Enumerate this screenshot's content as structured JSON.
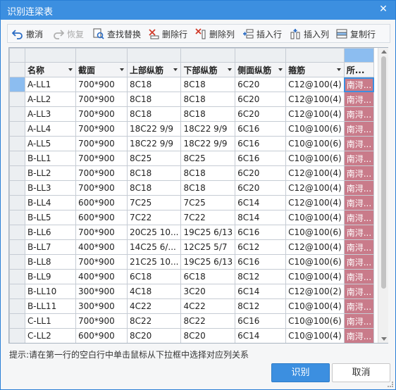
{
  "window": {
    "title": "识别连梁表",
    "close_glyph": "✕"
  },
  "toolbar": {
    "undo": "撤消",
    "redo": "恢复",
    "find_replace": "查找替换",
    "delete_row": "删除行",
    "delete_col": "删除列",
    "insert_row": "插入行",
    "insert_col": "插入列",
    "copy_row": "复制行"
  },
  "table": {
    "columns": [
      "名称",
      "截面",
      "上部纵筋",
      "下部纵筋",
      "侧面纵筋",
      "箍筋",
      "所..."
    ],
    "rows": [
      [
        "A-LL1",
        "700*900",
        "8C18",
        "8C18",
        "6C20",
        "C12@100(4)",
        "南浔..."
      ],
      [
        "A-LL2",
        "700*900",
        "8C18",
        "8C18",
        "6C20",
        "C12@100(4)",
        "南浔..."
      ],
      [
        "A-LL3",
        "700*900",
        "8C18",
        "8C18",
        "6C20",
        "C12@100(4)",
        "南浔..."
      ],
      [
        "A-LL4",
        "700*900",
        "18C22 9/9",
        "18C22 9/9",
        "6C16",
        "C10@100(6)",
        "南浔..."
      ],
      [
        "A-LL5",
        "700*900",
        "18C22 9/9",
        "18C22 9/9",
        "6C16",
        "C10@100(6)",
        "南浔..."
      ],
      [
        "B-LL1",
        "700*900",
        "8C25",
        "8C25",
        "6C16",
        "C10@100(6)",
        "南浔..."
      ],
      [
        "B-LL2",
        "700*900",
        "8C18",
        "8C18",
        "6C20",
        "C12@100(4)",
        "南浔..."
      ],
      [
        "B-LL3",
        "700*900",
        "8C18",
        "8C18",
        "6C20",
        "C12@100(4)",
        "南浔..."
      ],
      [
        "B-LL4",
        "600*900",
        "7C25",
        "7C25",
        "6C14",
        "C12@100(4)",
        "南浔..."
      ],
      [
        "B-LL5",
        "600*900",
        "7C22",
        "7C22",
        "8C14",
        "C10@100(4)",
        "南浔..."
      ],
      [
        "B-LL6",
        "700*900",
        "20C25 10...",
        "19C25 6/13",
        "6C16",
        "C10@100(6)",
        "南浔..."
      ],
      [
        "B-LL7",
        "400*900",
        "14C25 6/...",
        "12C25 5/7",
        "6C12",
        "C12@100(4)",
        "南浔..."
      ],
      [
        "B-LL8",
        "700*900",
        "21C25 10...",
        "19C25 6/13",
        "6C16",
        "C10@100(6)",
        "南浔..."
      ],
      [
        "B-LL9",
        "400*900",
        "6C18",
        "6C18",
        "8C12",
        "C10@100(4)",
        "南浔..."
      ],
      [
        "B-LL10",
        "300*900",
        "4C18",
        "3C20",
        "6C14",
        "C12@100(2)",
        "南浔..."
      ],
      [
        "B-LL11",
        "300*900",
        "4C22",
        "4C22",
        "8C12",
        "C10@100(4)",
        "南浔..."
      ],
      [
        "C-LL1",
        "700*900",
        "8C22",
        "8C22",
        "6C16",
        "C10@100(6)",
        "南浔..."
      ],
      [
        "C-LL2",
        "600*900",
        "8C20",
        "8C20",
        "6C14",
        "C10@100(4)",
        "南浔..."
      ]
    ]
  },
  "hint": "提示:请在第一行的空白行中单击鼠标从下拉框中选择对应列关系",
  "buttons": {
    "ok": "识别",
    "cancel": "取消"
  },
  "colors": {
    "accent": "#3c8fe0",
    "highlight_col": "#c97b8a",
    "row_selected": "#8cbdf0"
  }
}
